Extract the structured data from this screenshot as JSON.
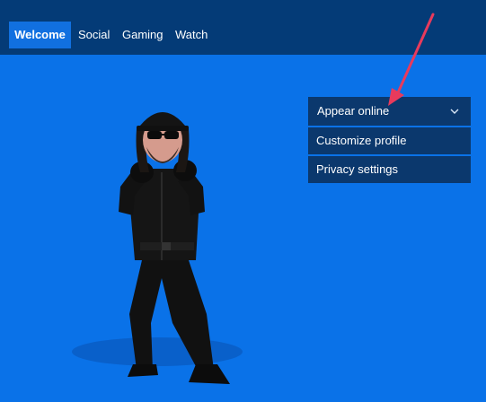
{
  "nav": {
    "tabs": [
      {
        "label": "Welcome",
        "active": true
      },
      {
        "label": "Social",
        "active": false
      },
      {
        "label": "Gaming",
        "active": false
      },
      {
        "label": "Watch",
        "active": false
      }
    ]
  },
  "presence": {
    "selected": "Appear online",
    "icon": "chevron-down-icon"
  },
  "menu": {
    "customize_profile": "Customize profile",
    "privacy_settings": "Privacy settings"
  },
  "colors": {
    "background": "#0a72e8",
    "top_bar": "#043b77",
    "active_tab": "#1170e0",
    "menu_bg": "#0b386d",
    "annotation_arrow": "#e83a5c"
  }
}
